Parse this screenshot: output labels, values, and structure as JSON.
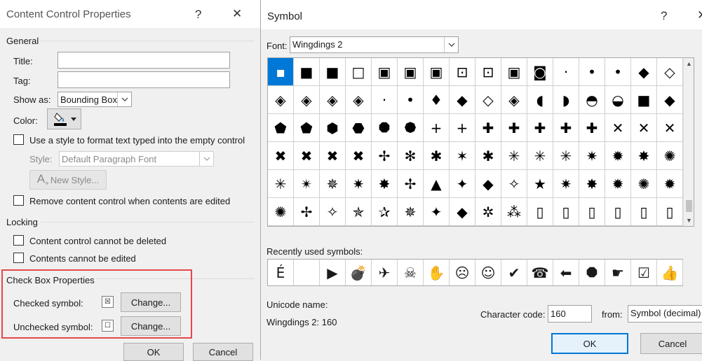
{
  "ccp": {
    "title": "Content Control Properties",
    "help": "?",
    "close": "✕",
    "general": "General",
    "title_label": "Title:",
    "title_value": "",
    "tag_label": "Tag:",
    "tag_value": "",
    "show_as_label": "Show as:",
    "show_as_value": "Bounding Box",
    "color_label": "Color:",
    "use_style_label": "Use a style to format text typed into the empty control",
    "style_label": "Style:",
    "style_value": "Default Paragraph Font",
    "new_style_label": "New Style...",
    "remove_label": "Remove content control when contents are edited",
    "locking": "Locking",
    "cannot_delete": "Content control cannot be deleted",
    "cannot_edit": "Contents cannot be edited",
    "checkbox_props": "Check Box Properties",
    "checked_symbol_label": "Checked symbol:",
    "checked_symbol": "☒",
    "unchecked_symbol_label": "Unchecked symbol:",
    "unchecked_symbol": "☐",
    "change_label": "Change...",
    "ok": "OK",
    "cancel": "Cancel"
  },
  "symbol": {
    "title": "Symbol",
    "help": "?",
    "close": "✕",
    "font_label": "Font:",
    "font_value": "Wingdings 2",
    "grid": [
      [
        "▪",
        "■",
        "■",
        "□",
        "▣",
        "▣",
        "▣",
        "⊡",
        "⊡",
        "▣",
        "◙",
        "·",
        "•",
        "•",
        "◆",
        "◇"
      ],
      [
        "◈",
        "◈",
        "◈",
        "◈",
        "·",
        "•",
        "♦",
        "◆",
        "◇",
        "◈",
        "◖",
        "◗",
        "◓",
        "◒",
        "■",
        "◆"
      ],
      [
        "⬟",
        "⬟",
        "⬢",
        "⬣",
        "⯃",
        "⯄",
        "+",
        "+",
        "✚",
        "✚",
        "✚",
        "✚",
        "✚",
        "✕",
        "✕",
        "✕"
      ],
      [
        "✖",
        "✖",
        "✖",
        "✖",
        "✢",
        "✻",
        "✱",
        "✶",
        "✱",
        "✳",
        "✳",
        "✳",
        "✷",
        "✹",
        "✸",
        "✺"
      ],
      [
        "✳",
        "✴",
        "✵",
        "✷",
        "✸",
        "✢",
        "▲",
        "✦",
        "◆",
        "✧",
        "★",
        "✷",
        "✸",
        "✹",
        "✺",
        "✹"
      ],
      [
        "✺",
        "✢",
        "✧",
        "✯",
        "✰",
        "✵",
        "✦",
        "◆",
        "✲",
        "⁂",
        "▯",
        "▯",
        "▯",
        "▯",
        "▯",
        "▯"
      ]
    ],
    "recent_label": "Recently used symbols:",
    "recent": [
      "É",
      "",
      "▶",
      "💣",
      "✈",
      "☠",
      "✋",
      "☹",
      "☺",
      "✔",
      "☎",
      "⬅",
      "⯃",
      "☛",
      "☑",
      "👍"
    ],
    "unicode_name_label": "Unicode name:",
    "unicode_name_value": "Wingdings 2: 160",
    "char_code_label": "Character code:",
    "char_code_value": "160",
    "from_label": "from:",
    "from_value": "Symbol (decimal)",
    "ok": "OK",
    "cancel": "Cancel"
  },
  "colors": {
    "accent": "#0078d7",
    "highlight_box": "#e5474b"
  }
}
